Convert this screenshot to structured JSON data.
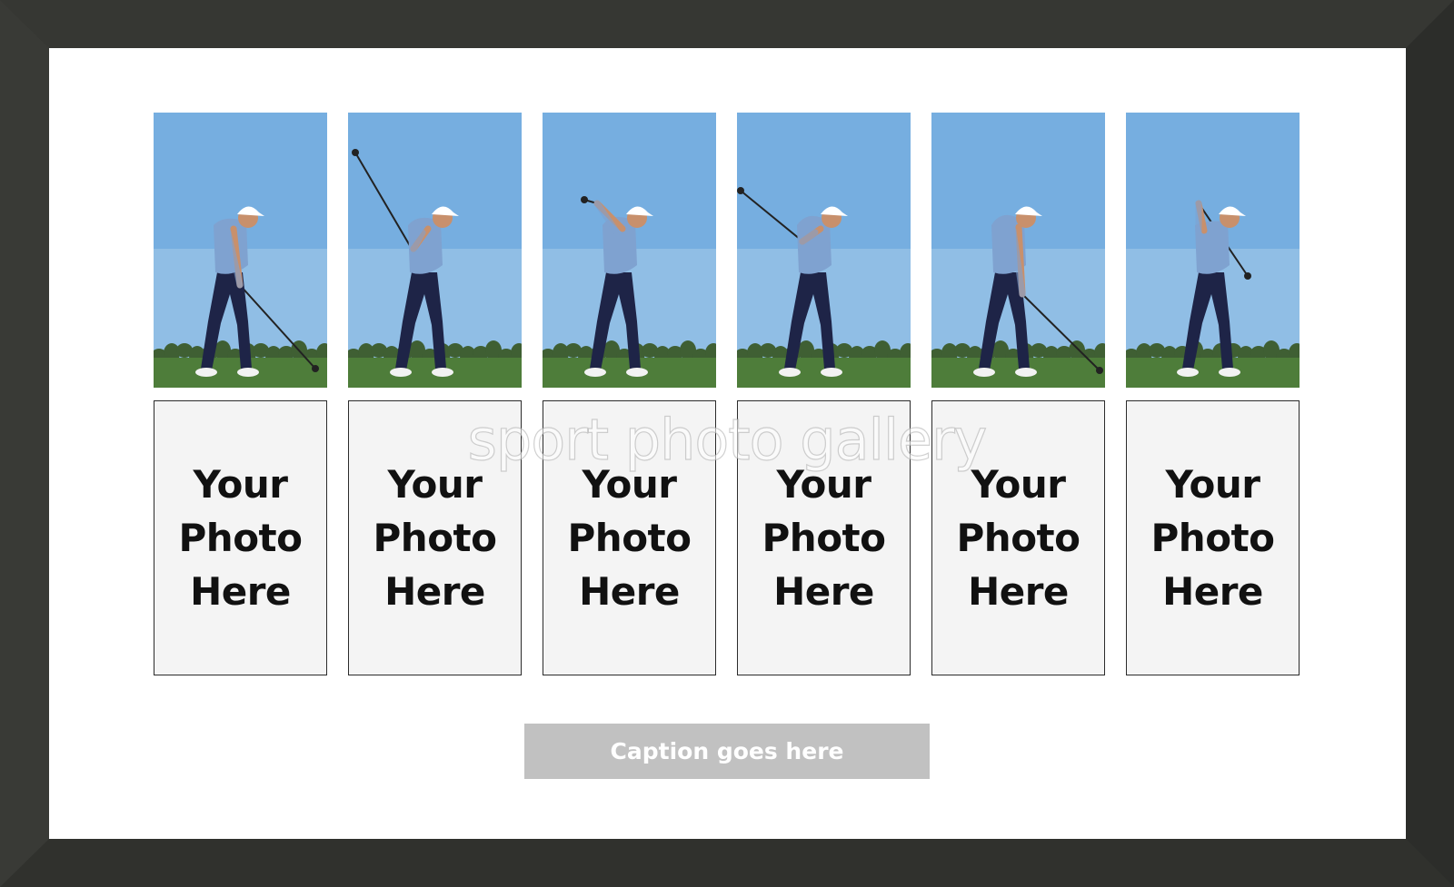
{
  "frame": {
    "color": "#333430",
    "mat_color": "#ffffff"
  },
  "photos": [
    {
      "icon": "golf-swing-address-photo"
    },
    {
      "icon": "golf-swing-backswing-photo"
    },
    {
      "icon": "golf-swing-top-photo"
    },
    {
      "icon": "golf-swing-downswing-photo"
    },
    {
      "icon": "golf-swing-impact-photo"
    },
    {
      "icon": "golf-swing-follow-through-photo"
    }
  ],
  "slots": [
    {
      "label": "Your\nPhoto\nHere"
    },
    {
      "label": "Your\nPhoto\nHere"
    },
    {
      "label": "Your\nPhoto\nHere"
    },
    {
      "label": "Your\nPhoto\nHere"
    },
    {
      "label": "Your\nPhoto\nHere"
    },
    {
      "label": "Your\nPhoto\nHere"
    }
  ],
  "watermark": "sport photo gallery",
  "caption": "Caption goes here",
  "colors": {
    "sky": "#76aee0",
    "grass": "#4e7d3a",
    "shirt": "#7fa2d0",
    "trousers": "#1e2447",
    "slot_bg": "#f4f4f4",
    "caption_bg": "#c1c1c1"
  }
}
